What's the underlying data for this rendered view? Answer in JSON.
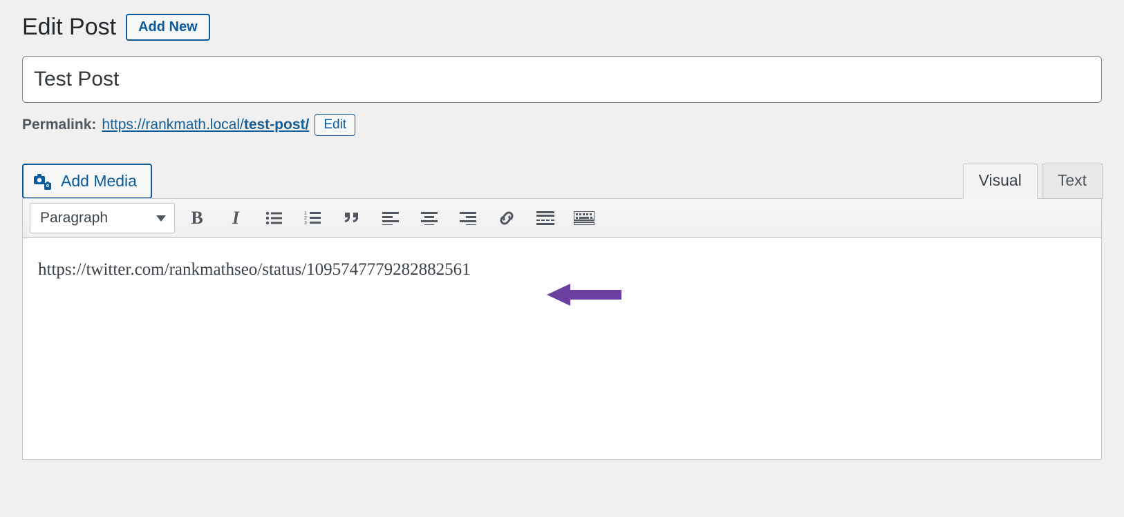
{
  "header": {
    "title": "Edit Post",
    "add_new_label": "Add New"
  },
  "post": {
    "title_value": "Test Post",
    "permalink_label": "Permalink:",
    "permalink_base": "https://rankmath.local/",
    "permalink_slug": "test-post/",
    "edit_label": "Edit"
  },
  "editor": {
    "add_media_label": "Add Media",
    "tabs": {
      "visual": "Visual",
      "text": "Text"
    },
    "format_select": "Paragraph",
    "content": "https://twitter.com/rankmathseo/status/1095747779282882561"
  },
  "toolbar": {
    "bold": "B",
    "italic": "I"
  },
  "annotation": {
    "arrow_color": "#6b3fa0"
  }
}
